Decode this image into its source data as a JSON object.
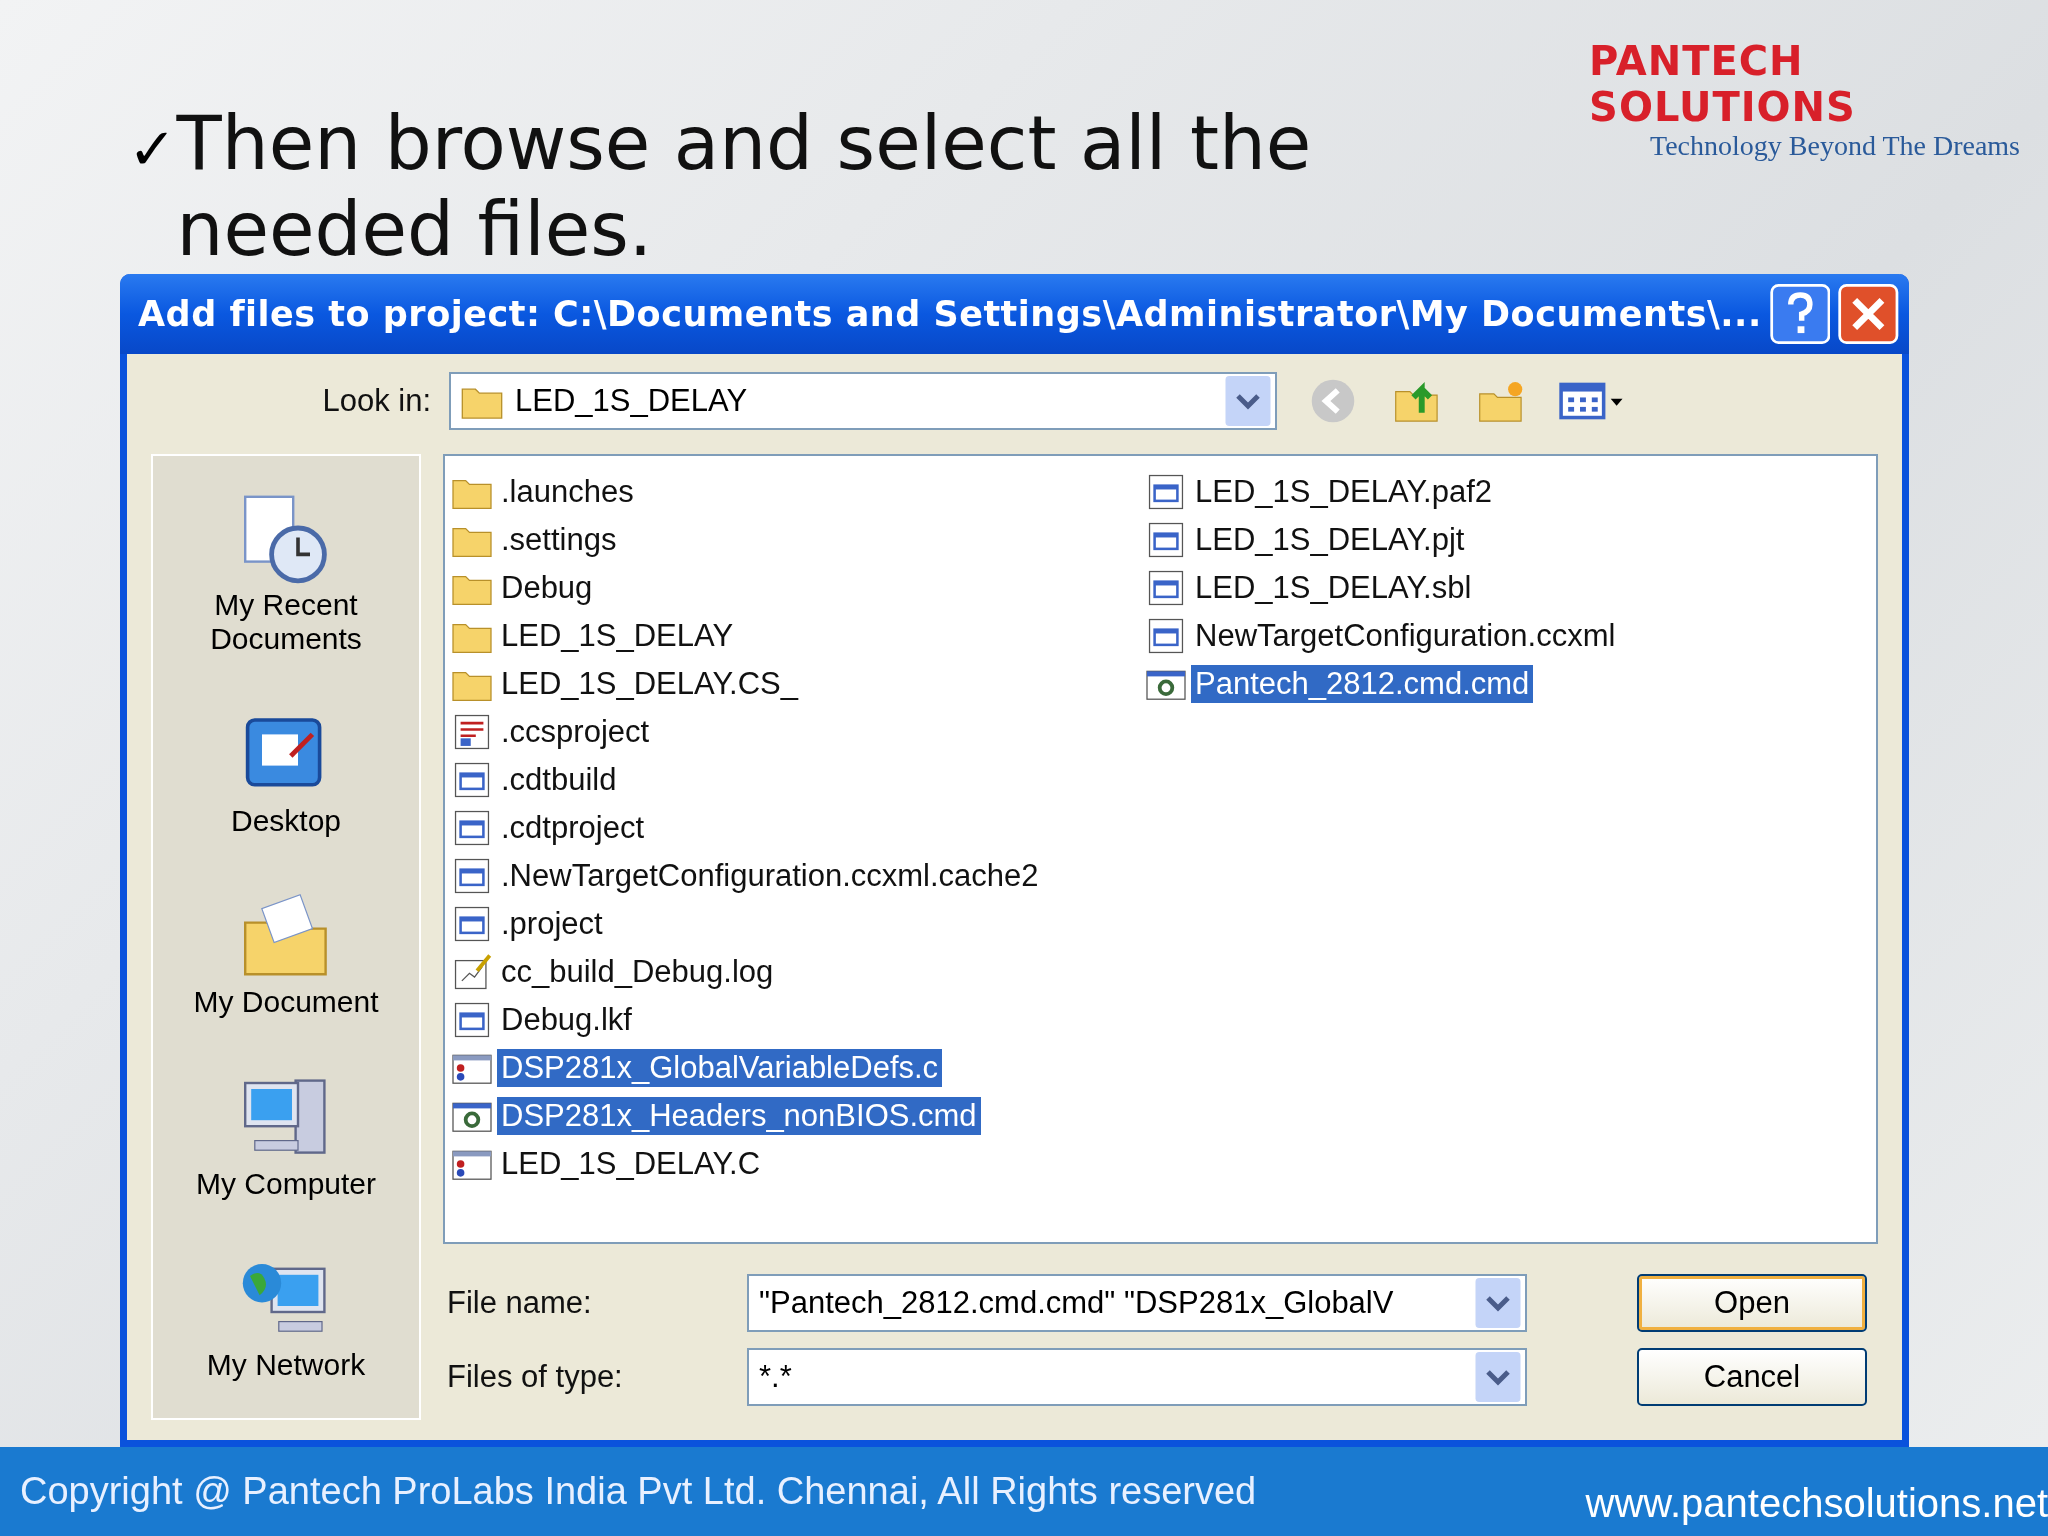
{
  "slide": {
    "check": "✓",
    "heading": "Then browse and select all the needed files.",
    "logo": {
      "name": "PANTECH SOLUTIONS",
      "tagline": "Technology Beyond The Dreams"
    }
  },
  "dialog": {
    "title": "Add files to project: C:\\Documents and Settings\\Administrator\\My Documents\\...",
    "look_in": {
      "label": "Look in:",
      "value": "LED_1S_DELAY"
    },
    "places": [
      {
        "label": "My Recent Documents",
        "kind": "recent"
      },
      {
        "label": "Desktop",
        "kind": "desktop"
      },
      {
        "label": "My Document",
        "kind": "documents"
      },
      {
        "label": "My Computer",
        "kind": "computer"
      },
      {
        "label": "My Network",
        "kind": "network"
      }
    ],
    "files": [
      {
        "name": ".launches",
        "kind": "folder",
        "selected": false
      },
      {
        "name": ".settings",
        "kind": "folder",
        "selected": false
      },
      {
        "name": "Debug",
        "kind": "folder",
        "selected": false
      },
      {
        "name": "LED_1S_DELAY",
        "kind": "folder",
        "selected": false
      },
      {
        "name": "LED_1S_DELAY.CS_",
        "kind": "folder",
        "selected": false
      },
      {
        "name": ".ccsproject",
        "kind": "project",
        "selected": false
      },
      {
        "name": ".cdtbuild",
        "kind": "doc",
        "selected": false
      },
      {
        "name": ".cdtproject",
        "kind": "doc",
        "selected": false
      },
      {
        "name": ".NewTargetConfiguration.ccxml.cache2",
        "kind": "doc",
        "selected": false
      },
      {
        "name": ".project",
        "kind": "doc",
        "selected": false
      },
      {
        "name": "cc_build_Debug.log",
        "kind": "log",
        "selected": false
      },
      {
        "name": "Debug.lkf",
        "kind": "doc",
        "selected": false
      },
      {
        "name": "DSP281x_GlobalVariableDefs.c",
        "kind": "source",
        "selected": true
      },
      {
        "name": "DSP281x_Headers_nonBIOS.cmd",
        "kind": "cmd",
        "selected": true
      },
      {
        "name": "LED_1S_DELAY.C",
        "kind": "source",
        "selected": false
      },
      {
        "name": "LED_1S_DELAY.paf2",
        "kind": "doc",
        "selected": false
      },
      {
        "name": "LED_1S_DELAY.pjt",
        "kind": "doc",
        "selected": false
      },
      {
        "name": "LED_1S_DELAY.sbl",
        "kind": "doc",
        "selected": false
      },
      {
        "name": "NewTargetConfiguration.ccxml",
        "kind": "doc",
        "selected": false
      },
      {
        "name": "Pantech_2812.cmd.cmd",
        "kind": "cmd",
        "selected": true
      }
    ],
    "file_name": {
      "label": "File name:",
      "value": "\"Pantech_2812.cmd.cmd\" \"DSP281x_GlobalV"
    },
    "files_of_type": {
      "label": "Files of type:",
      "value": "*.*"
    },
    "buttons": [
      "Open",
      "Cancel"
    ]
  },
  "footer": {
    "copyright": "Copyright @ Pantech ProLabs India Pvt Ltd. Chennai, All Rights reserved",
    "website": "www.pantechsolutions.net"
  }
}
